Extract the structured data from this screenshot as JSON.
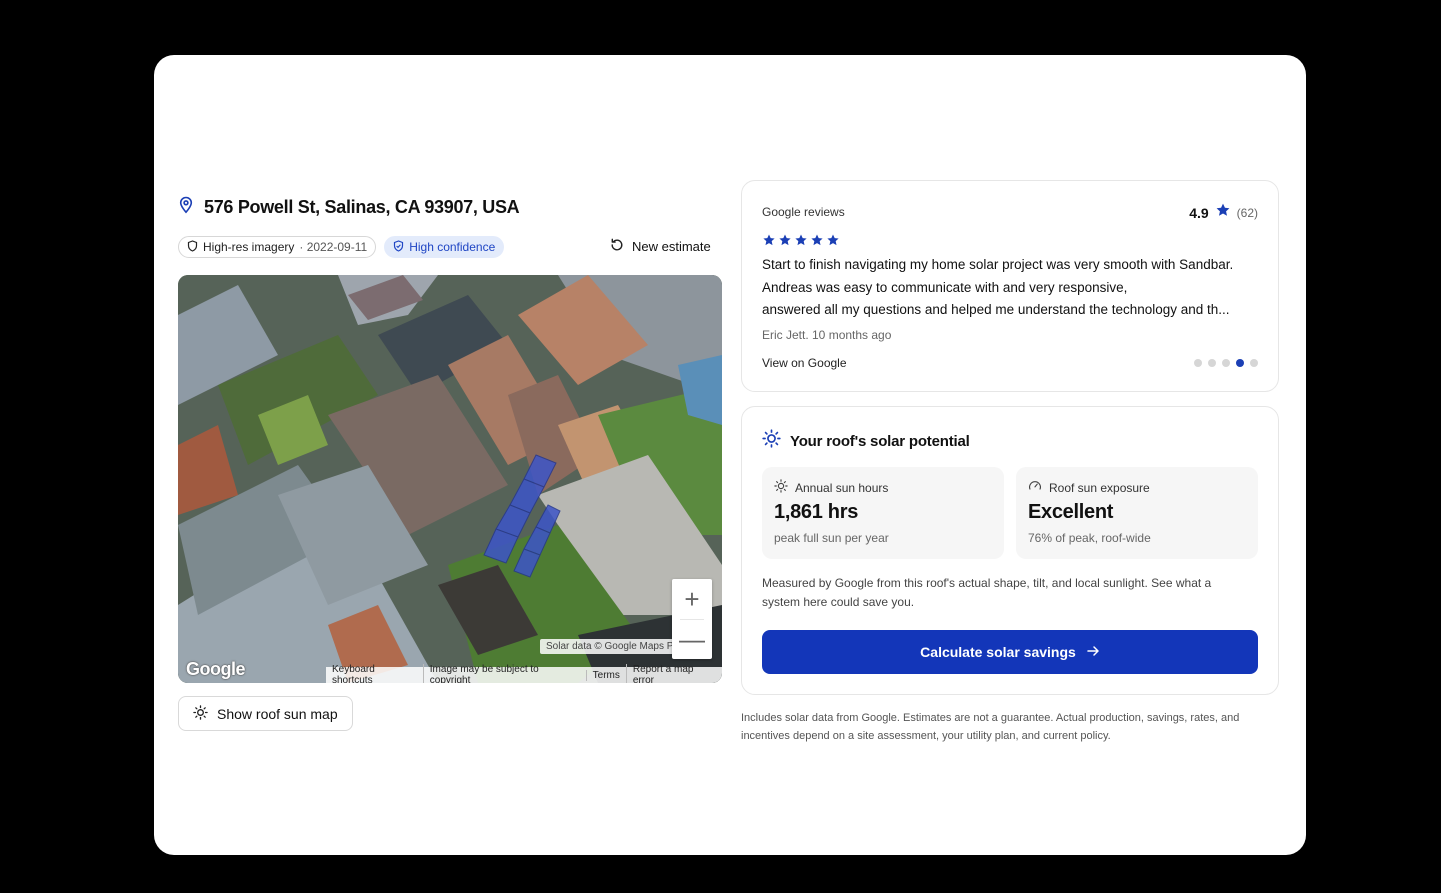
{
  "address": {
    "text": "576 Powell St, Salinas, CA 93907, USA",
    "icon": "map-pin-icon"
  },
  "chips": {
    "imagery_label": "High-res imagery",
    "imagery_date": "· 2022-09-11",
    "confidence_label": "High confidence"
  },
  "new_estimate_label": "New estimate",
  "map": {
    "attribution_top": "Solar data © Google Maps Platform",
    "footer_links": [
      "Keyboard shortcuts",
      "Image may be subject to copyright",
      "Terms",
      "Report a map error"
    ],
    "logo_text": "Google",
    "zoom_in": "+",
    "zoom_out": "—"
  },
  "show_sun_map_label": "Show roof sun map",
  "reviews": {
    "title": "Google reviews",
    "score": "4.9",
    "count": "(62)",
    "stars": 5,
    "text_main": "Start to finish navigating my home solar project was very smooth with Sandbar. Andreas was easy to communicate with and very responsive,",
    "text_last": "answered all my questions and helped me understand the technology and th...",
    "author": "Eric Jett. 10 months ago",
    "link": "View on Google",
    "pagination": {
      "total": 5,
      "active_index": 3
    }
  },
  "solar": {
    "title": "Your roof's solar potential",
    "stat1": {
      "label": "Annual sun hours",
      "value": "1,861 hrs",
      "sub": "peak full sun per year"
    },
    "stat2": {
      "label": "Roof sun exposure",
      "value": "Excellent",
      "sub": "76% of peak, roof-wide"
    },
    "description": "Measured by Google from this roof's actual shape, tilt, and local sunlight. See what a system here could save you.",
    "cta_label": "Calculate solar savings"
  },
  "disclaimer": "Includes solar data from Google. Estimates are not a guarantee. Actual production, savings, rates, and incentives depend on a site assessment, your utility plan, and current policy.",
  "colors": {
    "accent": "#1336b9",
    "confidence_bg": "#e3ebfb",
    "star": "#1b3fb5"
  }
}
